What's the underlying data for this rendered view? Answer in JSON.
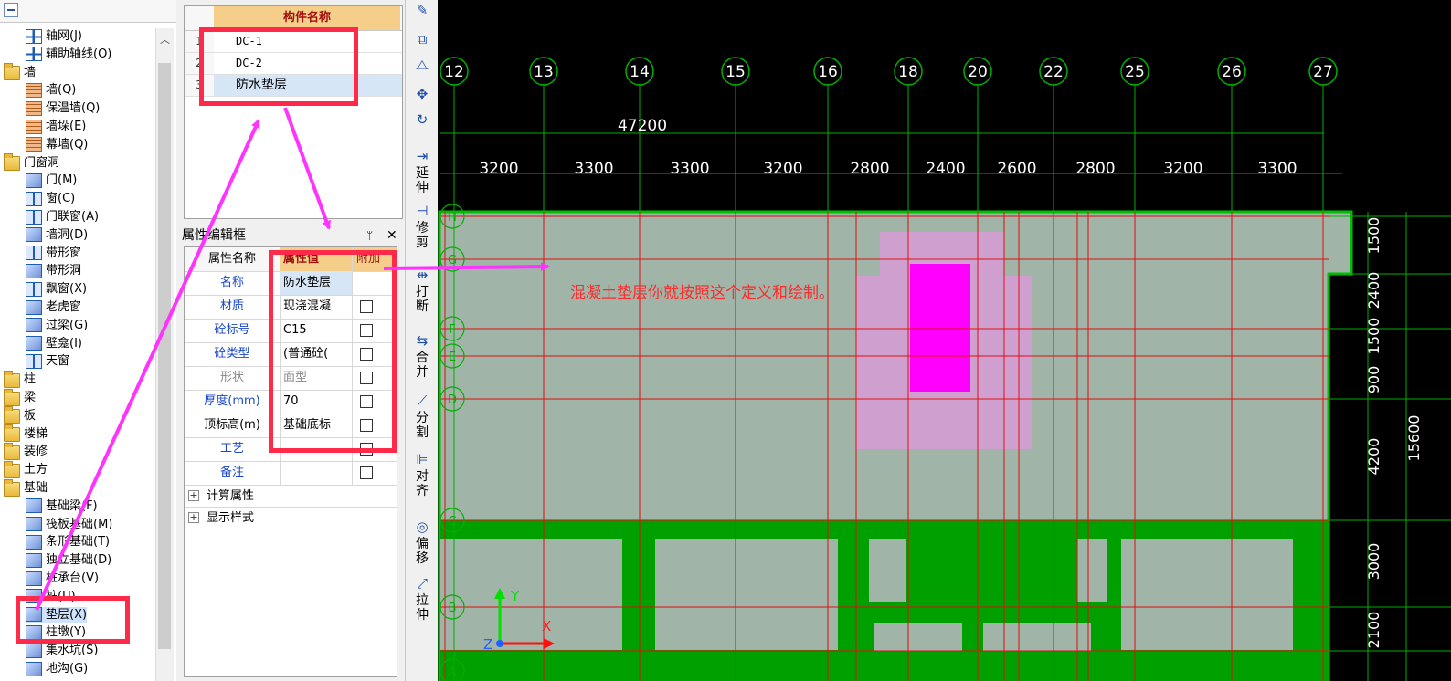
{
  "tree": {
    "items": [
      {
        "label": "轴网(J)",
        "icon": "grid-icon",
        "level": 2
      },
      {
        "label": "辅助轴线(O)",
        "icon": "aux-axis-icon",
        "level": 2
      },
      {
        "label": "墙",
        "icon": "folder-icon",
        "level": 1
      },
      {
        "label": "墙(Q)",
        "icon": "wall-icon",
        "level": 2
      },
      {
        "label": "保温墙(Q)",
        "icon": "insulation-wall-icon",
        "level": 2
      },
      {
        "label": "墙垛(E)",
        "icon": "wall-pier-icon",
        "level": 2
      },
      {
        "label": "幕墙(Q)",
        "icon": "curtain-wall-icon",
        "level": 2
      },
      {
        "label": "门窗洞",
        "icon": "folder-icon",
        "level": 1
      },
      {
        "label": "门(M)",
        "icon": "door-icon",
        "level": 2
      },
      {
        "label": "窗(C)",
        "icon": "window-icon",
        "level": 2
      },
      {
        "label": "门联窗(A)",
        "icon": "door-window-icon",
        "level": 2
      },
      {
        "label": "墙洞(D)",
        "icon": "wall-hole-icon",
        "level": 2
      },
      {
        "label": "带形窗",
        "icon": "strip-window-icon",
        "level": 2
      },
      {
        "label": "带形洞",
        "icon": "strip-hole-icon",
        "level": 2
      },
      {
        "label": "飘窗(X)",
        "icon": "bay-window-icon",
        "level": 2
      },
      {
        "label": "老虎窗",
        "icon": "dormer-icon",
        "level": 2
      },
      {
        "label": "过梁(G)",
        "icon": "lintel-icon",
        "level": 2
      },
      {
        "label": "壁龛(I)",
        "icon": "niche-icon",
        "level": 2
      },
      {
        "label": "天窗",
        "icon": "skylight-icon",
        "level": 2
      },
      {
        "label": "柱",
        "icon": "folder-icon",
        "level": 1
      },
      {
        "label": "梁",
        "icon": "folder-icon",
        "level": 1
      },
      {
        "label": "板",
        "icon": "folder-icon",
        "level": 1
      },
      {
        "label": "楼梯",
        "icon": "folder-icon",
        "level": 1
      },
      {
        "label": "装修",
        "icon": "folder-icon",
        "level": 1
      },
      {
        "label": "土方",
        "icon": "folder-icon",
        "level": 1
      },
      {
        "label": "基础",
        "icon": "folder-icon",
        "level": 1
      },
      {
        "label": "基础梁(F)",
        "icon": "foundation-beam-icon",
        "level": 2
      },
      {
        "label": "筏板基础(M)",
        "icon": "raft-foundation-icon",
        "level": 2
      },
      {
        "label": "条形基础(T)",
        "icon": "strip-foundation-icon",
        "level": 2
      },
      {
        "label": "独立基础(D)",
        "icon": "isolated-foundation-icon",
        "level": 2
      },
      {
        "label": "桩承台(V)",
        "icon": "pile-cap-icon",
        "level": 2
      },
      {
        "label": "桩(U)",
        "icon": "pile-icon",
        "level": 2
      },
      {
        "label": "垫层(X)",
        "icon": "cushion-icon",
        "level": 2,
        "selected": true
      },
      {
        "label": "柱墩(Y)",
        "icon": "column-pier-icon",
        "level": 2
      },
      {
        "label": "集水坑(S)",
        "icon": "sump-icon",
        "level": 2
      },
      {
        "label": "地沟(G)",
        "icon": "trench-icon",
        "level": 2
      }
    ]
  },
  "components": {
    "header": "构件名称",
    "rows": [
      {
        "num": "1",
        "name": "DC-1"
      },
      {
        "num": "2",
        "name": "DC-2"
      },
      {
        "num": "3",
        "name": "防水垫层",
        "selected": true
      }
    ]
  },
  "props": {
    "title": "属性编辑框",
    "pin": "ᛘ",
    "close": "✕",
    "col_name": "属性名称",
    "col_value": "属性值",
    "col_extra": "附加",
    "rows": [
      {
        "name": "名称",
        "value": "防水垫层",
        "check": false
      },
      {
        "name": "材质",
        "value": "现浇混凝",
        "check": true
      },
      {
        "name": "砼标号",
        "value": "C15",
        "check": true
      },
      {
        "name": "砼类型",
        "value": "(普通砼(",
        "check": true
      },
      {
        "name": "形状",
        "value": "面型",
        "check": true,
        "gray": true
      },
      {
        "name": "厚度(mm)",
        "value": "70",
        "check": true
      },
      {
        "name": "顶标高(m)",
        "value": "基础底标",
        "check": true,
        "black": true
      },
      {
        "name": "工艺",
        "value": "",
        "check": true
      },
      {
        "name": "备注",
        "value": "",
        "check": true
      }
    ],
    "groups": [
      "计算属性",
      "显示样式"
    ]
  },
  "toolbar": {
    "buttons": [
      {
        "icon": "brush-icon"
      },
      {
        "icon": "copy-icon"
      },
      {
        "icon": "mirror-icon"
      },
      {
        "icon": "move-icon"
      },
      {
        "icon": "rotate-icon"
      },
      {
        "icon": "extend-icon",
        "label": "延伸"
      },
      {
        "icon": "trim-icon",
        "label": "修剪"
      },
      {
        "icon": "break-icon",
        "label": "打断"
      },
      {
        "icon": "merge-icon",
        "label": "合并"
      },
      {
        "icon": "split-icon",
        "label": "分割"
      },
      {
        "icon": "align-icon",
        "label": "对齐"
      },
      {
        "icon": "offset-icon",
        "label": "偏移"
      },
      {
        "icon": "stretch-icon",
        "label": "拉伸"
      }
    ]
  },
  "canvas": {
    "axis_labels": [
      "12",
      "13",
      "14",
      "15",
      "16",
      "18",
      "20",
      "22",
      "25",
      "26",
      "27"
    ],
    "total_dim": "47200",
    "spans": [
      "3200",
      "3300",
      "3300",
      "3200",
      "2800",
      "2400",
      "2600",
      "2800",
      "3200",
      "3300"
    ],
    "row_labels": [
      "H",
      "G",
      "F",
      "E",
      "D",
      "C",
      "B",
      "A"
    ],
    "right_dims": [
      "1500",
      "2400",
      "1500",
      "900",
      "4200",
      "3000",
      "2100"
    ],
    "right_total": "15600",
    "annotation": "混凝土垫层你就按照这个定义和绘制。",
    "ucs": {
      "x": "X",
      "y": "Y",
      "z": "Z"
    },
    "colors": {
      "accent": "#ff2a4a",
      "arrow": "#ff33ff",
      "grid": "#00a000",
      "fill": "#a0b4a8"
    }
  }
}
